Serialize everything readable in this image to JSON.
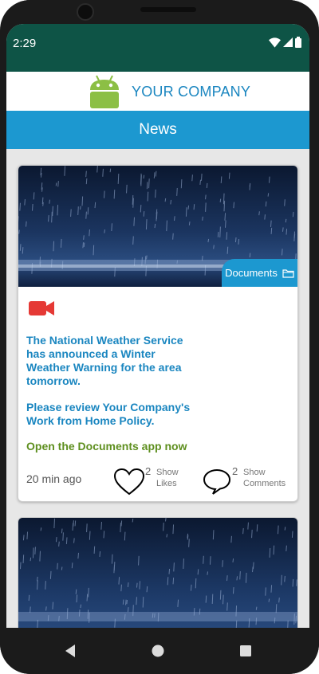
{
  "status_bar": {
    "time": "2:29",
    "wifi_icon": "wifi-icon",
    "signal_icon": "signal-icon",
    "battery_icon": "battery-icon"
  },
  "header": {
    "logo_icon": "android-logo-icon",
    "company_name": "YOUR COMPANY"
  },
  "news_bar": {
    "title": "News"
  },
  "post": {
    "documents_tab": {
      "label": "Documents",
      "icon": "folder-icon"
    },
    "video_icon": "video-camera-icon",
    "message_1": "The National Weather Service has announced a Winter Weather Warning for the area tomorrow.",
    "message_2": "Please review Your Company's Work from Home Policy.",
    "action_link": "Open the Documents app now",
    "timestamp": "20 min ago",
    "likes": {
      "count": "2",
      "label_line1": "Show",
      "label_line2": "Likes",
      "icon": "heart-icon"
    },
    "comments": {
      "count": "2",
      "label_line1": "Show",
      "label_line2": "Comments",
      "icon": "comment-bubble-icon"
    }
  },
  "nav_bar": {
    "back_icon": "back-icon",
    "home_icon": "home-icon",
    "recents_icon": "recents-icon"
  },
  "colors": {
    "status_bar": "#0e5446",
    "accent_blue": "#1c98d0",
    "link_text": "#1a86c0",
    "action_green": "#5e8f1f",
    "video_red": "#e53935"
  }
}
